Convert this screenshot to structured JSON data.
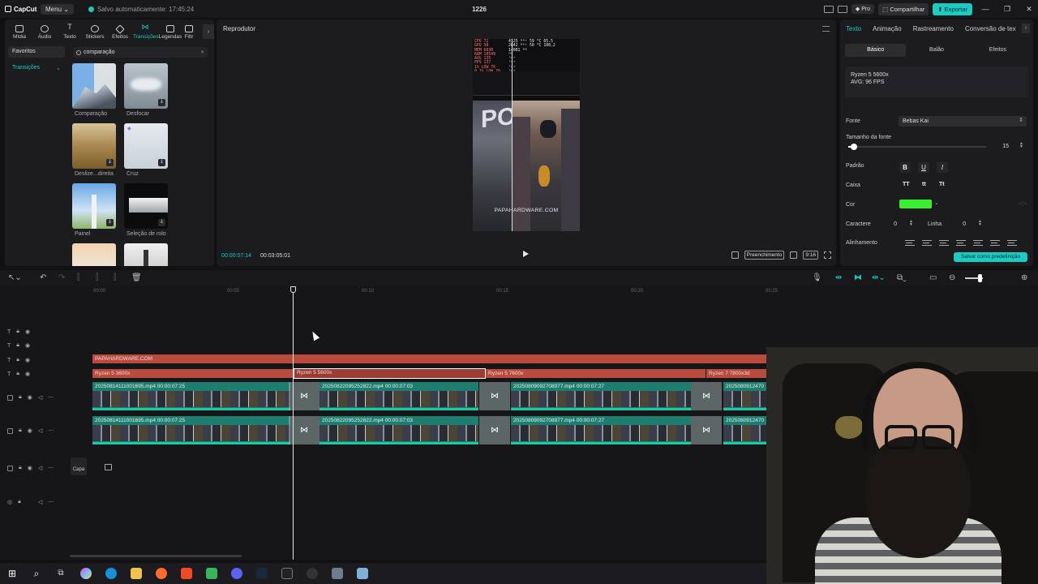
{
  "app": {
    "name": "CapCut",
    "menu_label": "Menu",
    "autosave_text": "Salvo automaticamente: 17:45:24",
    "project_title": "1226",
    "pro_label": "Pro",
    "share_label": "Compartilhar",
    "export_label": "Exportar",
    "accent_color": "#1ec9c2"
  },
  "media_tabs": [
    {
      "label": "Mídia",
      "icon": "media-icon"
    },
    {
      "label": "Áudio",
      "icon": "audio-icon"
    },
    {
      "label": "Texto",
      "icon": "text-icon"
    },
    {
      "label": "Stickers",
      "icon": "sticker-icon"
    },
    {
      "label": "Efeitos",
      "icon": "effects-icon"
    },
    {
      "label": "Transições",
      "icon": "transitions-icon",
      "active": true
    },
    {
      "label": "Legendas",
      "icon": "captions-icon"
    },
    {
      "label": "Filtr",
      "icon": "filters-icon"
    }
  ],
  "categories": {
    "favorites": "Favoritos",
    "selected": "Transições"
  },
  "search": {
    "value": "comparação"
  },
  "transitions": [
    {
      "label": "Comparação"
    },
    {
      "label": "Desfocar"
    },
    {
      "label": "Deslize...direita"
    },
    {
      "label": "Cruz"
    },
    {
      "label": "Painel"
    },
    {
      "label": "Seleção de rolo"
    }
  ],
  "player": {
    "title": "Reprodutor",
    "current_time": "00:00:07:14",
    "total_time": "00:03:05:01",
    "fill_label": "Preenchimento",
    "ratio_label": "9:16",
    "watermark": "PAPAHARDWARE.COM",
    "osd_left": [
      "CPU      72",
      "GPU      38",
      "MEM    6630",
      "RAM   10549",
      "AVG     135",
      "FPS     137",
      "1% LOW   76",
      "0.1% LOW 70"
    ],
    "osd_right": [
      "4125 ᴹᴴᶻ  59 °C 65.5",
      "2842 ᴹᴴᶻ  50 °C 108.2",
      "14081 ᴹᴮ",
      "ᴹᴮ",
      "ᶠᵖˢ",
      "ᶠᵖˢ",
      "ᶠᵖˢ",
      "ᶠᵖˢ"
    ]
  },
  "inspector": {
    "tabs": [
      "Texto",
      "Animação",
      "Rastreamento",
      "Conversão de tex"
    ],
    "sub_tabs": [
      "Básico",
      "Balão",
      "Efeitos"
    ],
    "text_lines": [
      "Ryzen 5 5600x",
      "AVG: 96 FPS"
    ],
    "font_label": "Fonte",
    "font_value": "Bebas Kai",
    "font_size_label": "Tamanho da fonte",
    "font_size_value": "15",
    "font_size_fraction": 0.04,
    "pattern_label": "Padrão",
    "pattern_buttons": [
      "B",
      "U",
      "I"
    ],
    "case_label": "Caixa",
    "case_buttons": [
      "TT",
      "tt",
      "Tt"
    ],
    "color_label": "Cor",
    "color_value": "#39ef2f",
    "char_spacing_label": "Caractere",
    "char_spacing_value": "0",
    "line_spacing_label": "Linha",
    "line_spacing_value": "0",
    "align_label": "Alinhamento",
    "save_preset_label": "Salvar como predefinição"
  },
  "timeline": {
    "ruler": [
      "00:00",
      "00:05",
      "00:10",
      "00:15",
      "00:20",
      "00:25"
    ],
    "text_clips": [
      {
        "label": "PAPAHARDWARE.COM"
      },
      {
        "label": "Ryzen 5 3600x"
      },
      {
        "label": "Ryzen 5 5600x",
        "selected": true
      },
      {
        "label": "Ryzen 5 7600x"
      },
      {
        "label": "Ryzen 7 7800x3d"
      }
    ],
    "video_clips": [
      {
        "label": "20250814111001695.mp4   00:00:07:25"
      },
      {
        "label": "20250822095252822.mp4   00:00:07:03"
      },
      {
        "label": "20250809092708977.mp4   00:00:07:27"
      },
      {
        "label": "2025080912470"
      }
    ],
    "cover_label": "Capa"
  }
}
